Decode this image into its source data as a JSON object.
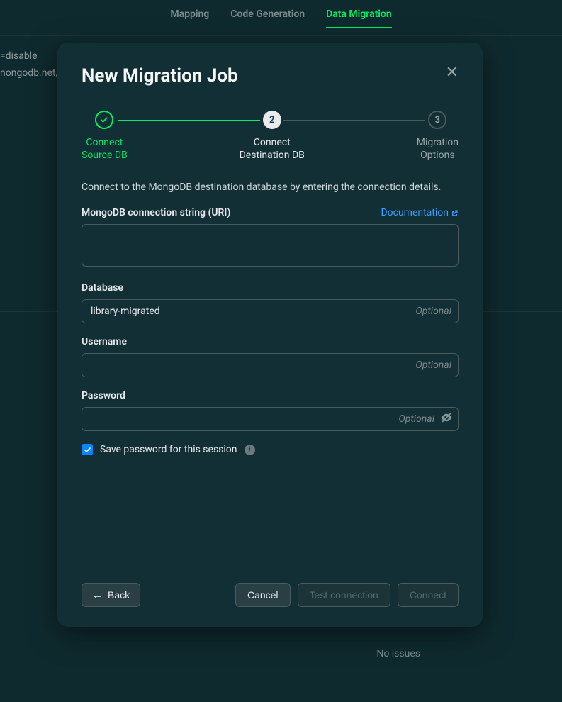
{
  "tabs": {
    "mapping": "Mapping",
    "code_gen": "Code Generation",
    "data_migration": "Data Migration"
  },
  "bg": {
    "line1": "=disable",
    "line2": "nongodb.net/",
    "footer": "No issues"
  },
  "modal": {
    "title": "New Migration Job",
    "steps": {
      "s1_l1": "Connect",
      "s1_l2": "Source DB",
      "s2_num": "2",
      "s2_l1": "Connect",
      "s2_l2": "Destination DB",
      "s3_num": "3",
      "s3_l1": "Migration",
      "s3_l2": "Options"
    },
    "description": "Connect to the MongoDB destination database by entering the connection details.",
    "uri_label": "MongoDB connection string (URI)",
    "doc_link": "Documentation",
    "uri_value": "",
    "db_label": "Database",
    "db_value": "library-migrated",
    "user_label": "Username",
    "user_value": "",
    "pw_label": "Password",
    "pw_value": "",
    "optional": "Optional",
    "save_pw": "Save password for this session",
    "buttons": {
      "back": "Back",
      "cancel": "Cancel",
      "test": "Test connection",
      "connect": "Connect"
    }
  }
}
